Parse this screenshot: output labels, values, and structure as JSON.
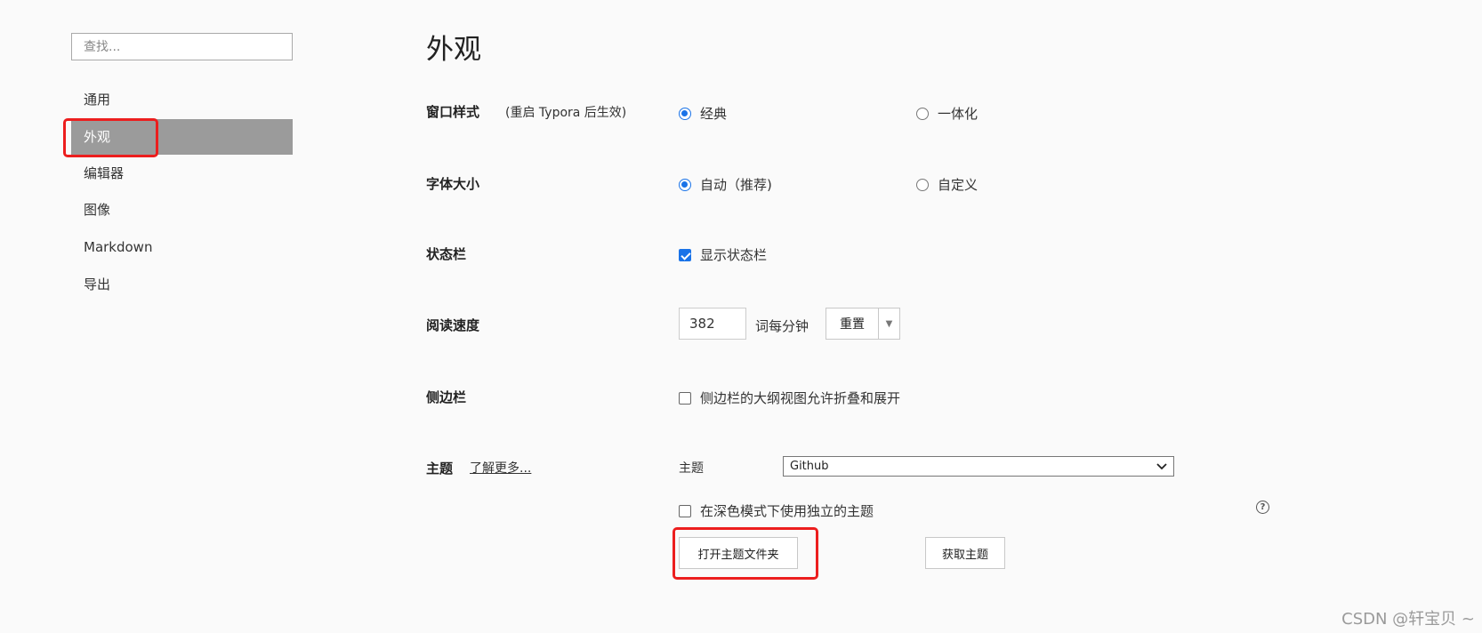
{
  "sidebar": {
    "search_placeholder": "查找...",
    "items": [
      {
        "label": "通用"
      },
      {
        "label": "外观",
        "active": true
      },
      {
        "label": "编辑器"
      },
      {
        "label": "图像"
      },
      {
        "label": "Markdown"
      },
      {
        "label": "导出"
      }
    ]
  },
  "main": {
    "title": "外观",
    "window_style": {
      "label": "窗口样式",
      "note": "(重启 Typora 后生效)",
      "options": [
        {
          "label": "经典",
          "selected": true
        },
        {
          "label": "一体化",
          "selected": false
        }
      ]
    },
    "font_size": {
      "label": "字体大小",
      "options": [
        {
          "label": "自动（推荐)",
          "selected": true
        },
        {
          "label": "自定义",
          "selected": false
        }
      ]
    },
    "status_bar": {
      "label": "状态栏",
      "checkbox_label": "显示状态栏",
      "checked": true
    },
    "reading_speed": {
      "label": "阅读速度",
      "value": "382",
      "unit": "词每分钟",
      "reset_label": "重置",
      "dropdown_glyph": "▼"
    },
    "sidebar_setting": {
      "label": "侧边栏",
      "checkbox_label": "侧边栏的大纲视图允许折叠和展开",
      "checked": false
    },
    "theme": {
      "label": "主题",
      "learn_more": "了解更多...",
      "select_label": "主题",
      "selected": "Github",
      "dark_mode_label": "在深色模式下使用独立的主题",
      "dark_mode_checked": false,
      "open_folder": "打开主题文件夹",
      "get_themes": "获取主题",
      "help_glyph": "?"
    }
  },
  "watermark": "CSDN @轩宝贝 ~",
  "colors": {
    "accent": "#1a73e8",
    "active_item": "#9b9b9b",
    "highlight_box": "#ec1e1e"
  }
}
